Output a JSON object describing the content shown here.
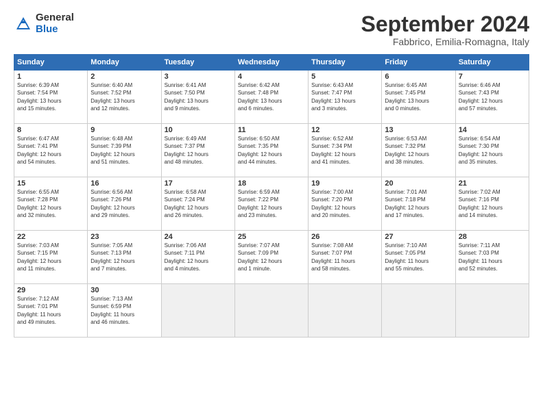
{
  "header": {
    "logo_general": "General",
    "logo_blue": "Blue",
    "title": "September 2024",
    "location": "Fabbrico, Emilia-Romagna, Italy"
  },
  "days_of_week": [
    "Sunday",
    "Monday",
    "Tuesday",
    "Wednesday",
    "Thursday",
    "Friday",
    "Saturday"
  ],
  "weeks": [
    [
      {
        "day": "1",
        "info": "Sunrise: 6:39 AM\nSunset: 7:54 PM\nDaylight: 13 hours\nand 15 minutes."
      },
      {
        "day": "2",
        "info": "Sunrise: 6:40 AM\nSunset: 7:52 PM\nDaylight: 13 hours\nand 12 minutes."
      },
      {
        "day": "3",
        "info": "Sunrise: 6:41 AM\nSunset: 7:50 PM\nDaylight: 13 hours\nand 9 minutes."
      },
      {
        "day": "4",
        "info": "Sunrise: 6:42 AM\nSunset: 7:48 PM\nDaylight: 13 hours\nand 6 minutes."
      },
      {
        "day": "5",
        "info": "Sunrise: 6:43 AM\nSunset: 7:47 PM\nDaylight: 13 hours\nand 3 minutes."
      },
      {
        "day": "6",
        "info": "Sunrise: 6:45 AM\nSunset: 7:45 PM\nDaylight: 13 hours\nand 0 minutes."
      },
      {
        "day": "7",
        "info": "Sunrise: 6:46 AM\nSunset: 7:43 PM\nDaylight: 12 hours\nand 57 minutes."
      }
    ],
    [
      {
        "day": "8",
        "info": "Sunrise: 6:47 AM\nSunset: 7:41 PM\nDaylight: 12 hours\nand 54 minutes."
      },
      {
        "day": "9",
        "info": "Sunrise: 6:48 AM\nSunset: 7:39 PM\nDaylight: 12 hours\nand 51 minutes."
      },
      {
        "day": "10",
        "info": "Sunrise: 6:49 AM\nSunset: 7:37 PM\nDaylight: 12 hours\nand 48 minutes."
      },
      {
        "day": "11",
        "info": "Sunrise: 6:50 AM\nSunset: 7:35 PM\nDaylight: 12 hours\nand 44 minutes."
      },
      {
        "day": "12",
        "info": "Sunrise: 6:52 AM\nSunset: 7:34 PM\nDaylight: 12 hours\nand 41 minutes."
      },
      {
        "day": "13",
        "info": "Sunrise: 6:53 AM\nSunset: 7:32 PM\nDaylight: 12 hours\nand 38 minutes."
      },
      {
        "day": "14",
        "info": "Sunrise: 6:54 AM\nSunset: 7:30 PM\nDaylight: 12 hours\nand 35 minutes."
      }
    ],
    [
      {
        "day": "15",
        "info": "Sunrise: 6:55 AM\nSunset: 7:28 PM\nDaylight: 12 hours\nand 32 minutes."
      },
      {
        "day": "16",
        "info": "Sunrise: 6:56 AM\nSunset: 7:26 PM\nDaylight: 12 hours\nand 29 minutes."
      },
      {
        "day": "17",
        "info": "Sunrise: 6:58 AM\nSunset: 7:24 PM\nDaylight: 12 hours\nand 26 minutes."
      },
      {
        "day": "18",
        "info": "Sunrise: 6:59 AM\nSunset: 7:22 PM\nDaylight: 12 hours\nand 23 minutes."
      },
      {
        "day": "19",
        "info": "Sunrise: 7:00 AM\nSunset: 7:20 PM\nDaylight: 12 hours\nand 20 minutes."
      },
      {
        "day": "20",
        "info": "Sunrise: 7:01 AM\nSunset: 7:18 PM\nDaylight: 12 hours\nand 17 minutes."
      },
      {
        "day": "21",
        "info": "Sunrise: 7:02 AM\nSunset: 7:16 PM\nDaylight: 12 hours\nand 14 minutes."
      }
    ],
    [
      {
        "day": "22",
        "info": "Sunrise: 7:03 AM\nSunset: 7:15 PM\nDaylight: 12 hours\nand 11 minutes."
      },
      {
        "day": "23",
        "info": "Sunrise: 7:05 AM\nSunset: 7:13 PM\nDaylight: 12 hours\nand 7 minutes."
      },
      {
        "day": "24",
        "info": "Sunrise: 7:06 AM\nSunset: 7:11 PM\nDaylight: 12 hours\nand 4 minutes."
      },
      {
        "day": "25",
        "info": "Sunrise: 7:07 AM\nSunset: 7:09 PM\nDaylight: 12 hours\nand 1 minute."
      },
      {
        "day": "26",
        "info": "Sunrise: 7:08 AM\nSunset: 7:07 PM\nDaylight: 11 hours\nand 58 minutes."
      },
      {
        "day": "27",
        "info": "Sunrise: 7:10 AM\nSunset: 7:05 PM\nDaylight: 11 hours\nand 55 minutes."
      },
      {
        "day": "28",
        "info": "Sunrise: 7:11 AM\nSunset: 7:03 PM\nDaylight: 11 hours\nand 52 minutes."
      }
    ],
    [
      {
        "day": "29",
        "info": "Sunrise: 7:12 AM\nSunset: 7:01 PM\nDaylight: 11 hours\nand 49 minutes."
      },
      {
        "day": "30",
        "info": "Sunrise: 7:13 AM\nSunset: 6:59 PM\nDaylight: 11 hours\nand 46 minutes."
      },
      {
        "day": "",
        "info": ""
      },
      {
        "day": "",
        "info": ""
      },
      {
        "day": "",
        "info": ""
      },
      {
        "day": "",
        "info": ""
      },
      {
        "day": "",
        "info": ""
      }
    ]
  ]
}
